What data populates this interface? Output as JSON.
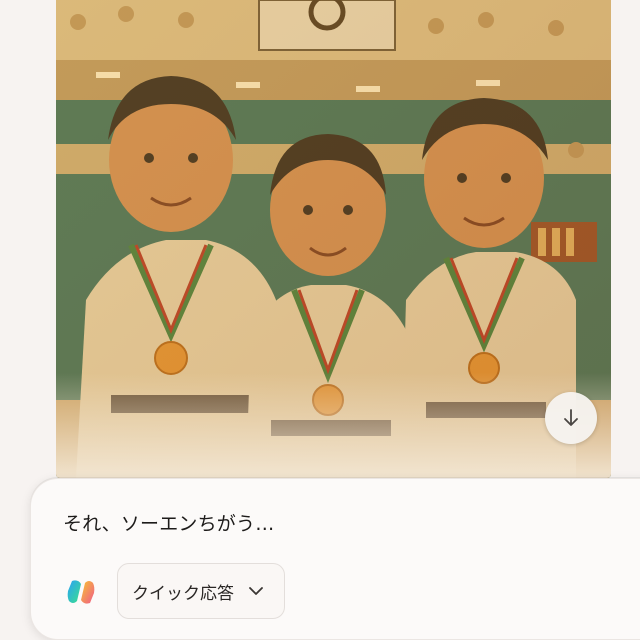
{
  "image": {
    "alt_subject": "three smiling figures in judo uniforms with medals",
    "tint_color": "#c98a3a"
  },
  "scroll_button": {
    "icon": "arrow-down-icon"
  },
  "composer": {
    "message_text": "それ、ソーエンちがう…",
    "mode_button_label": "クイック応答",
    "mode_icon": "chevron-down-icon"
  },
  "colors": {
    "background": "#f7f3f1",
    "composer_bg": "#fcfaf9",
    "text": "#1d1b1a"
  }
}
